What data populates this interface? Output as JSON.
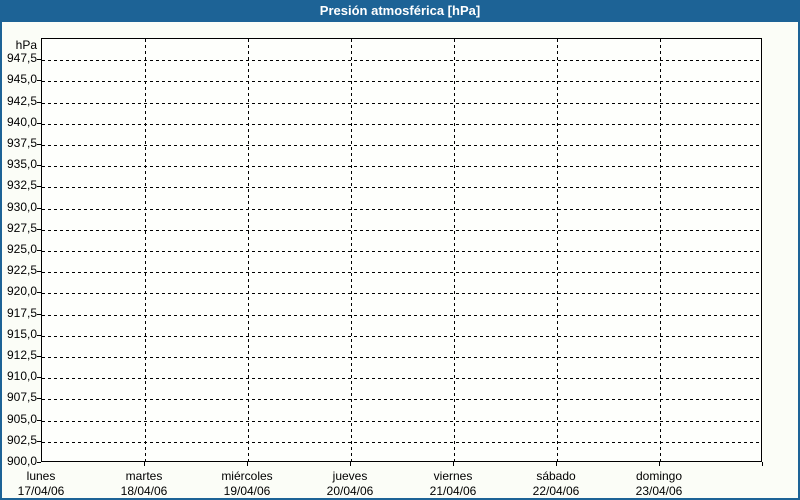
{
  "window": {
    "title": "Presión atmosférica [hPa]"
  },
  "colors": {
    "frame_blue": "#1d6396",
    "titlebar_blue": "#1d6396",
    "title_text": "#ffffff",
    "page_background": "#fbfdf7",
    "plot_background": "#fefffc",
    "grid_and_text": "#000000"
  },
  "y_axis": {
    "unit_label": "hPa",
    "tick_labels": [
      "947,5",
      "945,0",
      "942,5",
      "940,0",
      "937,5",
      "935,0",
      "932,5",
      "930,0",
      "927,5",
      "925,0",
      "922,5",
      "920,0",
      "917,5",
      "915,0",
      "912,5",
      "910,0",
      "907,5",
      "905,0",
      "902,5",
      "900,0"
    ]
  },
  "x_axis": {
    "day_names": [
      "lunes",
      "martes",
      "miércoles",
      "jueves",
      "viernes",
      "sábado",
      "domingo"
    ],
    "day_dates": [
      "17/04/06",
      "18/04/06",
      "19/04/06",
      "20/04/06",
      "21/04/06",
      "22/04/06",
      "23/04/06"
    ]
  },
  "chart_data": {
    "type": "line",
    "title": "Presión atmosférica [hPa]",
    "ylabel": "hPa",
    "ylim": [
      900,
      950
    ],
    "ytick_step": 2.5,
    "yticks": [
      900,
      902.5,
      905,
      907.5,
      910,
      912.5,
      915,
      917.5,
      920,
      922.5,
      925,
      927.5,
      930,
      932.5,
      935,
      937.5,
      940,
      942.5,
      945,
      947.5
    ],
    "x_categories": [
      "lunes 17/04/06",
      "martes 18/04/06",
      "miércoles 19/04/06",
      "jueves 20/04/06",
      "viernes 21/04/06",
      "sábado 22/04/06",
      "domingo 23/04/06"
    ],
    "series": [],
    "grid": true,
    "grid_style": "dashed",
    "legend_position": "none"
  }
}
